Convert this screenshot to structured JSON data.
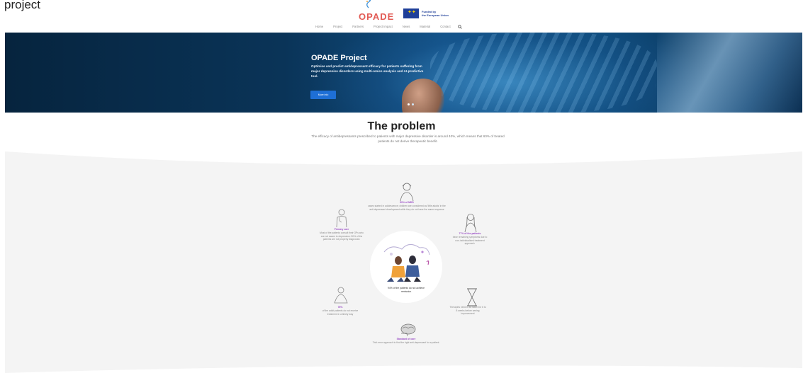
{
  "tab": {
    "title": "project"
  },
  "header": {
    "logo_text": "OPADE",
    "eu_line1": "Funded by",
    "eu_line2": "the European Union"
  },
  "nav": {
    "items": [
      "Home",
      "Project",
      "Partners",
      "Project Impact",
      "News",
      "Material",
      "Contact"
    ],
    "search_icon": "search-icon"
  },
  "hero": {
    "title": "OPADE Project",
    "subtitle": "Optimise and predict antidepressant efficacy for patients suffering from major depressive disorders using multi-omics analysis and AI-predictive tool.",
    "button": "More info",
    "slides": 2,
    "active_slide": 1
  },
  "problem": {
    "title": "The problem",
    "description": "The efficacy of antidepressants prescribed to patients with major depressive disorder is around 40%, which means that 60% of treated patients do not derive therapeutic benefit.",
    "center_text": "94% of the patients do not achieve remission",
    "items": [
      {
        "title": "50% of MDD",
        "text": "cases started in adolescence; children are considered as 'little adults' in the anti-depressant development while they do not have the same response"
      },
      {
        "title": "Primary care",
        "text": "Most of the patients consult their GPs who are not aware to depression: 50% of the patients are not properly diagnosed."
      },
      {
        "title": "77% of the patients",
        "text": "have remaining symptoms due to non-individualised treatment approach."
      },
      {
        "title": "78%",
        "text": "of the adult patients do not receive treatment in a timely way"
      },
      {
        "title": "",
        "text": "Therapies need to be taken for 6 to 8 weeks before seeing improvement"
      },
      {
        "title": "Standard of care",
        "text": "Trial-error approach to find the right anti-depressant for a patient."
      }
    ]
  },
  "colors": {
    "hero_dark": "#06243e",
    "hero_button": "#1e6fd6",
    "accent_purple": "#9b4fc6",
    "logo_red": "#e25b55",
    "eu_blue": "#1f3f99",
    "grey_area": "#f4f4f4"
  }
}
